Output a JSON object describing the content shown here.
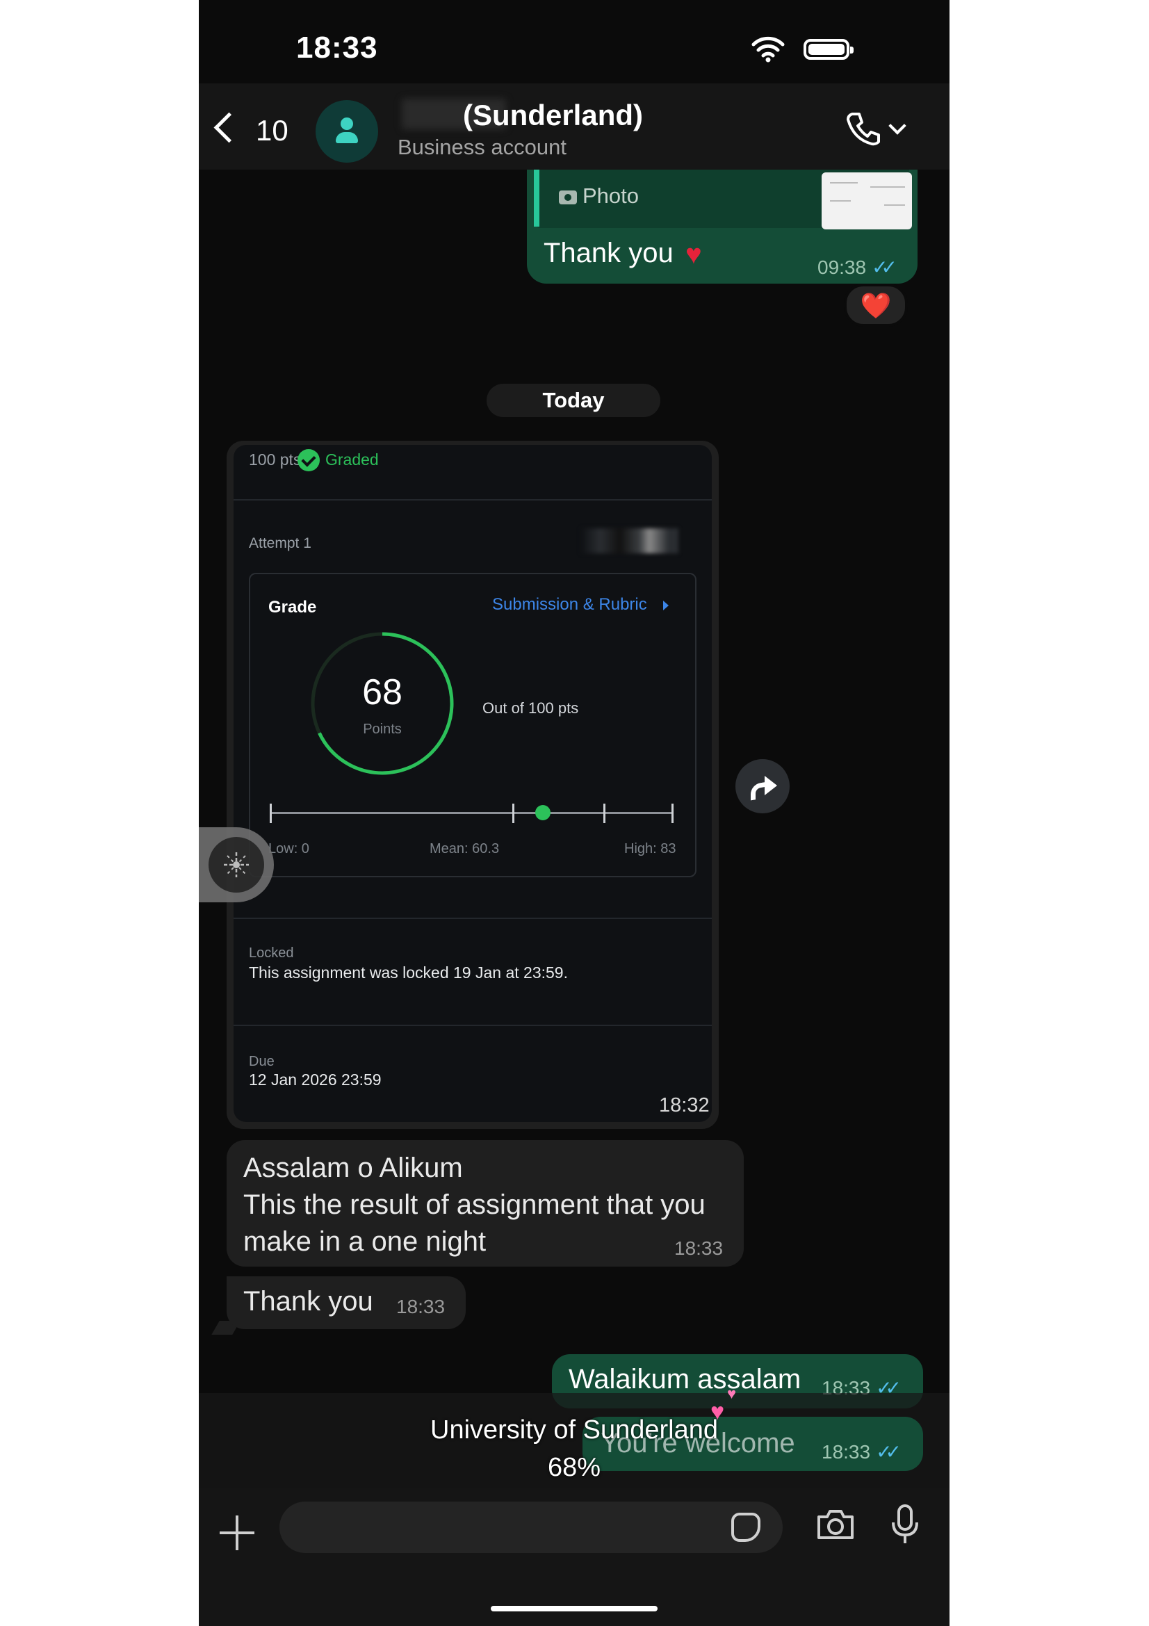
{
  "status_bar": {
    "time": "18:33"
  },
  "header": {
    "back_count": "10",
    "contact_name": "(Sunderland)",
    "contact_subtitle": "Business account",
    "icons": [
      "chevron-left-icon",
      "avatar-person-icon",
      "phone-icon",
      "chevron-down-icon"
    ]
  },
  "messages": {
    "photo_reply": {
      "quote_label": "Photo",
      "text": "Thank you",
      "time": "09:38",
      "reaction": "❤️"
    },
    "date_divider": "Today",
    "grade_image": {
      "time": "18:32",
      "points_label": "100 pts",
      "graded_label": "Graded",
      "attempt_label": "Attempt 1",
      "grade_title": "Grade",
      "link_label": "Submission & Rubric",
      "score": "68",
      "score_unit": "Points",
      "score_fraction": 0.68,
      "out_of": "Out of 100 pts",
      "distribution": {
        "low": 0,
        "mean": 60.3,
        "high": 83,
        "score": 68,
        "max": 100
      },
      "low_label": "Low: 0",
      "mean_label": "Mean: 60.3",
      "high_label": "High: 83",
      "locked_label": "Locked",
      "locked_text": "This assignment was locked 19 Jan at 23:59.",
      "due_label": "Due",
      "due_text": "12 Jan 2026 23:59"
    },
    "incoming_1": {
      "lines": [
        "Assalam o Alikum",
        "This the result of assignment that you",
        "make in a one night"
      ],
      "time": "18:33"
    },
    "incoming_2": {
      "text": "Thank you",
      "time": "18:33"
    },
    "outgoing_1": {
      "text": "Walaikum assalam",
      "time": "18:33"
    },
    "outgoing_2": {
      "text": "You're welcome",
      "time": "18:33"
    }
  },
  "overlay_caption": {
    "line1": "University of Sunderland",
    "line2": "68%",
    "emoji": "💕"
  },
  "input_bar": {
    "placeholder": "",
    "icons": [
      "plus-icon",
      "sticker-icon",
      "camera-icon",
      "microphone-icon"
    ]
  },
  "colors": {
    "outgoing_bubble": "#144d37",
    "incoming_bubble": "#1f1f1f",
    "accent_green": "#2cc15a",
    "link_blue": "#3d86e8",
    "read_ticks": "#53bdeb"
  }
}
